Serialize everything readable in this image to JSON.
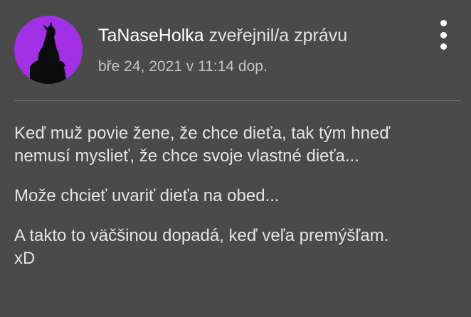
{
  "post": {
    "author": "TaNaseHolka",
    "action": "zveřejnil/a zprávu",
    "timestamp": "bře 24, 2021 v 11:14 dop.",
    "paragraphs": [
      [
        "Keď muž povie žene, že chce dieťa, tak tým hneď",
        "nemusí myslieť, že chce svoje vlastné dieťa..."
      ],
      [
        "Može chcieť uvariť dieťa na obed..."
      ],
      [
        "A takto to väčšinou dopadá, keď veľa premýšľam.",
        "xD"
      ]
    ]
  },
  "avatar": {
    "icon": "wolf-howling-icon",
    "background_color": "#a231e6"
  },
  "menu": {
    "icon": "more-vertical-icon"
  }
}
